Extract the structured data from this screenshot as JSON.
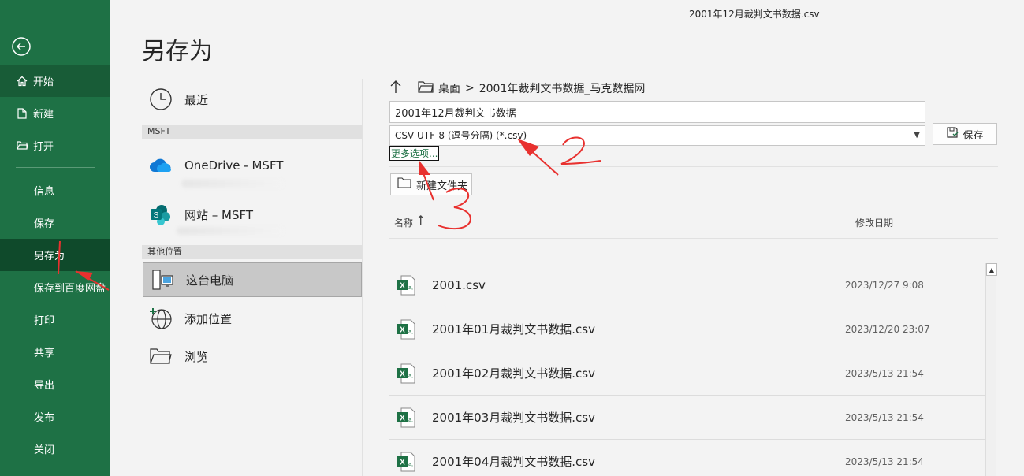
{
  "window": {
    "doc_title": "2001年12月裁判文书数据.csv"
  },
  "nav": {
    "back_label": "",
    "items": [
      {
        "label": "开始",
        "icon": "home-icon"
      },
      {
        "label": "新建",
        "icon": "new-document-icon"
      },
      {
        "label": "打开",
        "icon": "open-folder-icon"
      },
      {
        "label": "信息"
      },
      {
        "label": "保存"
      },
      {
        "label": "另存为"
      },
      {
        "label": "保存到百度网盘"
      },
      {
        "label": "打印"
      },
      {
        "label": "共享"
      },
      {
        "label": "导出"
      },
      {
        "label": "发布"
      },
      {
        "label": "关闭"
      }
    ]
  },
  "page_title": "另存为",
  "locations": {
    "recent": "最近",
    "section_msft": "MSFT",
    "onedrive": "OneDrive - MSFT",
    "sites": "网站 – MSFT",
    "section_other": "其他位置",
    "this_pc": "这台电脑",
    "add_place": "添加位置",
    "browse": "浏览"
  },
  "save_pane": {
    "breadcrumb_root": "桌面",
    "breadcrumb_sep": ">",
    "breadcrumb_folder": "2001年裁判文书数据_马克数据网",
    "filename": "2001年12月裁判文书数据",
    "filetype": "CSV UTF-8 (逗号分隔) (*.csv)",
    "save_label": "保存",
    "more_options": "更多选项...",
    "new_folder": "新建文件夹",
    "col_name": "名称",
    "col_date": "修改日期"
  },
  "files": [
    {
      "name": "2001.csv",
      "date": "2023/12/27 9:08"
    },
    {
      "name": "2001年01月裁判文书数据.csv",
      "date": "2023/12/20 23:07"
    },
    {
      "name": "2001年02月裁判文书数据.csv",
      "date": "2023/5/13 21:54"
    },
    {
      "name": "2001年03月裁判文书数据.csv",
      "date": "2023/5/13 21:54"
    },
    {
      "name": "2001年04月裁判文书数据.csv",
      "date": "2023/5/13 21:54"
    }
  ],
  "annotations": {
    "mark_2": "2",
    "mark_3": "3"
  },
  "colors": {
    "nav_bg": "#1e7145",
    "nav_selected": "#0f4a2b",
    "annotation": "#e8312f",
    "excel_green": "#1e7145"
  }
}
